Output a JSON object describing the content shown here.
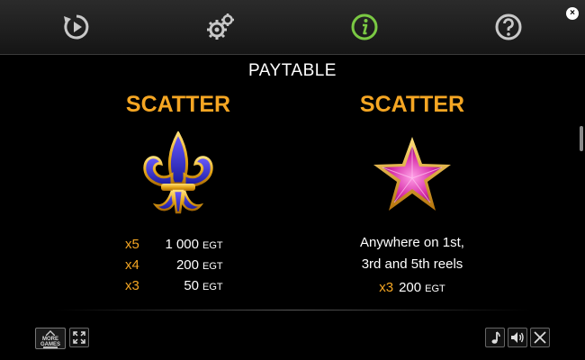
{
  "topbar": {
    "icons": [
      "replay-icon",
      "settings-gears-icon",
      "info-icon",
      "help-icon"
    ],
    "active_icon": "info-icon",
    "active_color": "#7ac943",
    "icon_color": "#c8c8c8"
  },
  "window": {
    "close_glyph": "×"
  },
  "page": {
    "title": "PAYTABLE"
  },
  "left_panel": {
    "title": "SCATTER",
    "symbol": "fleur-de-lis-icon",
    "payouts": [
      {
        "mult": "x5",
        "amount": "1 000",
        "currency": "EGT"
      },
      {
        "mult": "x4",
        "amount": "200",
        "currency": "EGT"
      },
      {
        "mult": "x3",
        "amount": "50",
        "currency": "EGT"
      }
    ]
  },
  "right_panel": {
    "title": "SCATTER",
    "symbol": "pink-star-icon",
    "description_line1": "Anywhere on 1st,",
    "description_line2": "3rd and 5th reels",
    "payouts": [
      {
        "mult": "x3",
        "amount": "200",
        "currency": "EGT"
      }
    ]
  },
  "bottombar": {
    "more_games_line1": "MORE",
    "more_games_line2": "GAMES",
    "buttons": [
      "more-games-icon",
      "fullscreen-icon",
      "music-icon",
      "sound-icon",
      "close-icon"
    ]
  },
  "colors": {
    "accent": "#f5a623",
    "background": "#000000"
  }
}
